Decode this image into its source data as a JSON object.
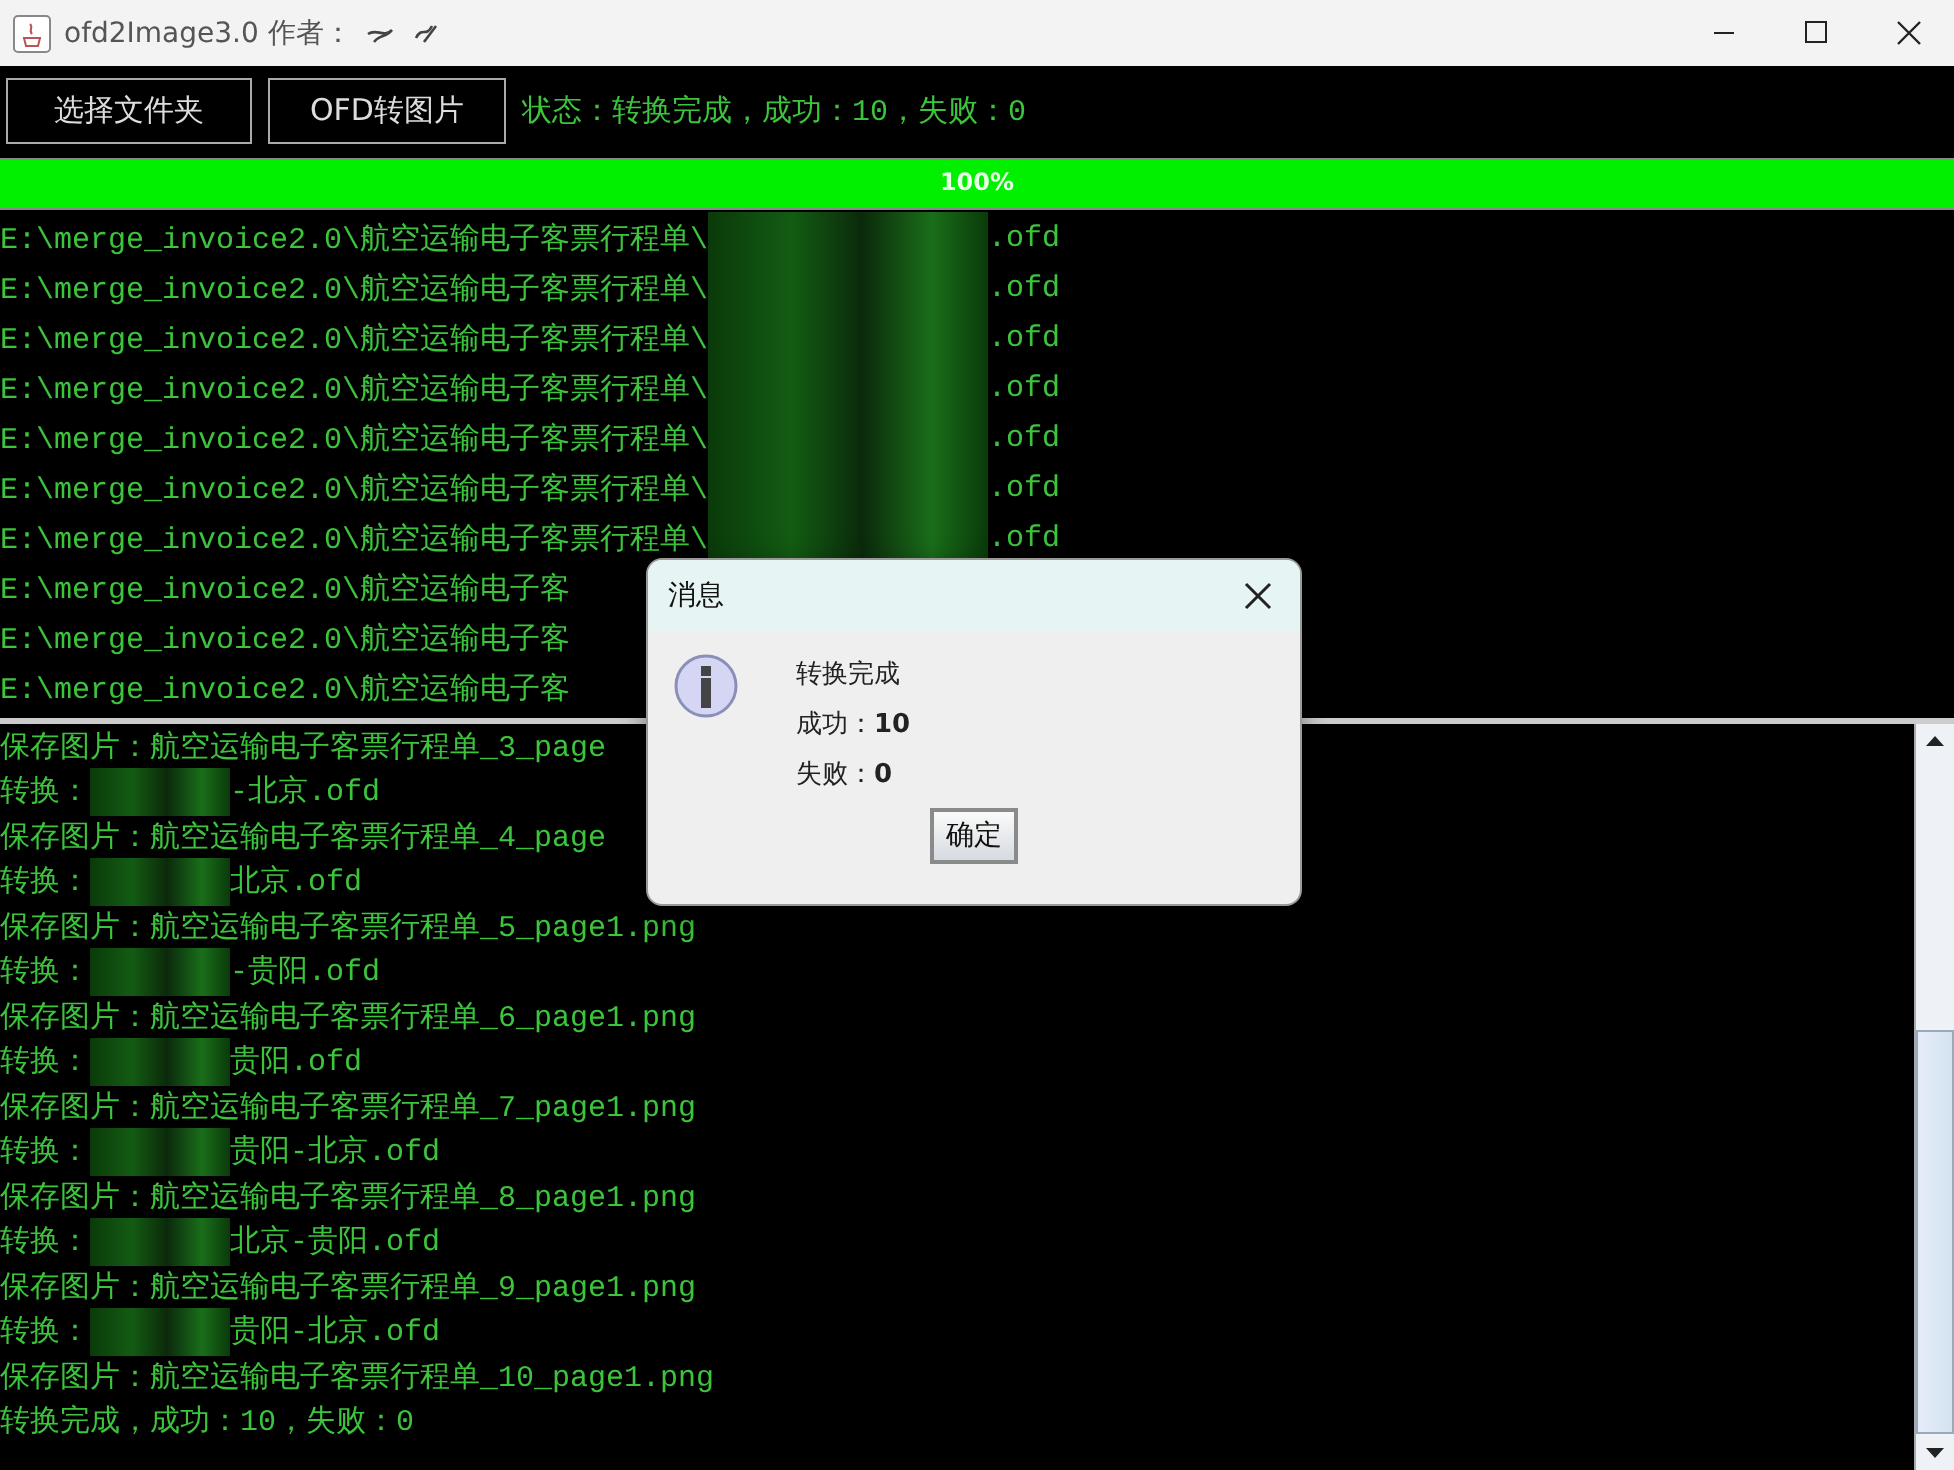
{
  "window": {
    "title": "ofd2Image3.0 作者："
  },
  "toolbar": {
    "buttons": [
      "选择文件夹",
      "OFD转图片"
    ],
    "status": "状态：转换完成，成功：10，失败：0"
  },
  "progress": {
    "level": 1,
    "reading": "100%"
  },
  "file_log": [
    {
      "prefix": "E:\\merge_invoice2.0\\航空运输电子客票行程单\\",
      "redacted": true,
      "suffix": ".ofd"
    },
    {
      "prefix": "E:\\merge_invoice2.0\\航空运输电子客票行程单\\",
      "redacted": true,
      "suffix": ".ofd"
    },
    {
      "prefix": "E:\\merge_invoice2.0\\航空运输电子客票行程单\\",
      "redacted": true,
      "suffix": ".ofd"
    },
    {
      "prefix": "E:\\merge_invoice2.0\\航空运输电子客票行程单\\",
      "redacted": true,
      "suffix": ".ofd"
    },
    {
      "prefix": "E:\\merge_invoice2.0\\航空运输电子客票行程单\\",
      "redacted": true,
      "suffix": ".ofd"
    },
    {
      "prefix": "E:\\merge_invoice2.0\\航空运输电子客票行程单\\",
      "redacted": true,
      "suffix": ".ofd"
    },
    {
      "prefix": "E:\\merge_invoice2.0\\航空运输电子客票行程单\\",
      "redacted": true,
      "suffix": ".ofd"
    },
    {
      "prefix": "E:\\merge_invoice2.0\\航空运输电子客",
      "redacted": false
    },
    {
      "prefix": "E:\\merge_invoice2.0\\航空运输电子客",
      "redacted": false
    },
    {
      "prefix": "E:\\merge_invoice2.0\\航空运输电子客",
      "redacted": false
    }
  ],
  "output_log": [
    {
      "prefix": "保存图片：航空运输电子客票行程单_3_page",
      "redacted": false
    },
    {
      "prefix": "转换：",
      "redacted": true,
      "suffix": "-北京.ofd"
    },
    {
      "prefix": "保存图片：航空运输电子客票行程单_4_page",
      "redacted": false
    },
    {
      "prefix": "转换：",
      "redacted": true,
      "suffix": "北京.ofd"
    },
    {
      "prefix": "保存图片：航空运输电子客票行程单_5_page1.png",
      "redacted": false
    },
    {
      "prefix": "转换：",
      "redacted": true,
      "suffix": "-贵阳.ofd"
    },
    {
      "prefix": "保存图片：航空运输电子客票行程单_6_page1.png",
      "redacted": false
    },
    {
      "prefix": "转换：",
      "redacted": true,
      "suffix": "贵阳.ofd"
    },
    {
      "prefix": "保存图片：航空运输电子客票行程单_7_page1.png",
      "redacted": false
    },
    {
      "prefix": "转换：",
      "redacted": true,
      "suffix": "贵阳-北京.ofd"
    },
    {
      "prefix": "保存图片：航空运输电子客票行程单_8_page1.png",
      "redacted": false
    },
    {
      "prefix": "转换：",
      "redacted": true,
      "suffix": "北京-贵阳.ofd"
    },
    {
      "prefix": "保存图片：航空运输电子客票行程单_9_page1.png",
      "redacted": false
    },
    {
      "prefix": "转换：",
      "redacted": true,
      "suffix": "贵阳-北京.ofd"
    },
    {
      "prefix": "保存图片：航空运输电子客票行程单_10_page1.png",
      "redacted": false
    },
    {
      "prefix": "转换完成，成功：10，失败：0",
      "redacted": false
    }
  ],
  "dialog": {
    "title": "消息",
    "lines": [
      "转换完成",
      "成功：**10**",
      "失败：**0**"
    ],
    "button": "确定"
  }
}
